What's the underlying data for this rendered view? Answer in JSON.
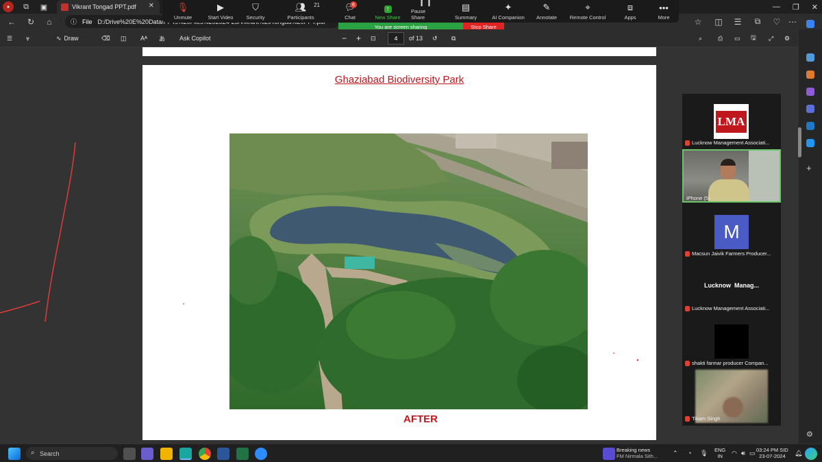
{
  "browser": {
    "tab_title": "Vikrant Tongad PPT.pdf",
    "url_scheme": "File",
    "url": "D:/Drive%20E%20Data/PPTs%20Files%202024-25/Vikrant%20Tongad%20PPT.pdf"
  },
  "zoom_toolbar": {
    "items": [
      {
        "label": "Unmute",
        "icon": "mic-off-icon"
      },
      {
        "label": "Start Video",
        "icon": "video-off-icon"
      },
      {
        "label": "Security",
        "icon": "shield-icon"
      },
      {
        "label": "Participants",
        "icon": "people-icon",
        "count": "21"
      },
      {
        "label": "Chat",
        "icon": "chat-icon",
        "badge": "6"
      },
      {
        "label": "New Share",
        "icon": "share-icon"
      },
      {
        "label": "Pause Share",
        "icon": "pause-icon"
      },
      {
        "label": "Summary",
        "icon": "summary-icon"
      },
      {
        "label": "AI Companion",
        "icon": "sparkle-icon"
      },
      {
        "label": "Annotate",
        "icon": "pen-icon"
      },
      {
        "label": "Remote Control",
        "icon": "remote-icon"
      },
      {
        "label": "Apps",
        "icon": "apps-icon"
      },
      {
        "label": "More",
        "icon": "more-icon"
      }
    ],
    "share_status": "You are screen sharing",
    "stop_share": "Stop Share"
  },
  "pdf_toolbar": {
    "draw": "Draw",
    "ask_copilot": "Ask Copilot",
    "current_page": "4",
    "page_total": "of 13",
    "zoom_out": "−",
    "zoom_in": "+"
  },
  "slide": {
    "title": "Ghaziabad Biodiversity Park",
    "caption": "AFTER"
  },
  "participants": [
    {
      "name": "Lucknow Management Associati...",
      "avatar": "LMA",
      "type": "logo"
    },
    {
      "name": "iPhone (5)",
      "type": "video"
    },
    {
      "name": "Macsun Jaivik Farmers Producer...",
      "avatar": "M",
      "type": "initial"
    },
    {
      "name": "Lucknow Management Associati...",
      "display": "Lucknow  Manag...",
      "type": "text"
    },
    {
      "name": "shakti farmar producer Compan...",
      "type": "black"
    },
    {
      "name": "Tikam Singh",
      "type": "video"
    }
  ],
  "taskbar": {
    "search": "Search",
    "news_title": "Breaking news",
    "news_sub": "FM Nirmala Sith...",
    "lang1": "ENG",
    "lang2": "IN",
    "time": "03:24 PM SID",
    "date": "23-07-2024"
  },
  "colors": {
    "title_red": "#c0171d",
    "share_green": "#2ba143",
    "stop_red": "#e02424"
  }
}
